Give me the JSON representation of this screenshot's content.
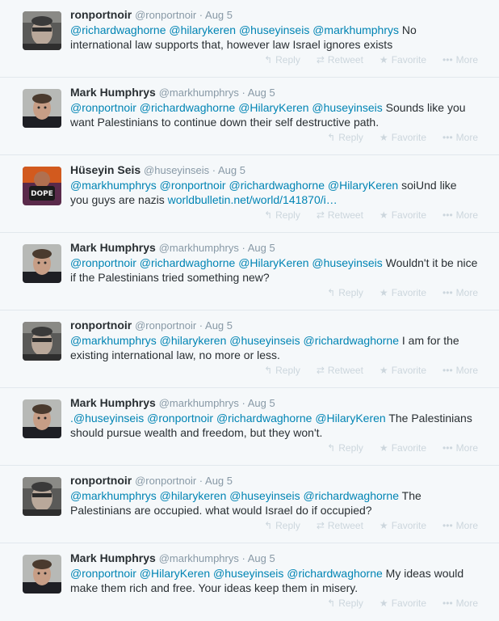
{
  "tweets": [
    {
      "avatar": "ronportnoir",
      "fullname": "ronportnoir",
      "username": "@ronportnoir",
      "date": "Aug 5",
      "mentions": "@richardwaghorne @hilarykeren @huseyinseis @markhumphrys",
      "text": " No international law supports that, however law Israel ignores exists",
      "link": "",
      "actions": {
        "reply": "Reply",
        "retweet": "Retweet",
        "favorite": "Favorite",
        "more": "More"
      }
    },
    {
      "avatar": "markhumphrys",
      "fullname": "Mark Humphrys",
      "username": "@markhumphrys",
      "date": "Aug 5",
      "mentions": "@ronportnoir @richardwaghorne @HilaryKeren @huseyinseis",
      "text": "  Sounds like you want Palestinians to continue down their self destructive path.",
      "link": "",
      "actions": {
        "reply": "Reply",
        "favorite": "Favorite",
        "more": "More"
      }
    },
    {
      "avatar": "huseyinseis",
      "fullname": "Hüseyin Seis",
      "username": "@huseyinseis",
      "date": "Aug 5",
      "mentions": "@markhumphrys @ronportnoir @richardwaghorne @HilaryKeren",
      "text": " soiUnd like you guys are nazis ",
      "link": "worldbulletin.net/world/141870/i…",
      "actions": {
        "reply": "Reply",
        "retweet": "Retweet",
        "favorite": "Favorite",
        "more": "More"
      }
    },
    {
      "avatar": "markhumphrys",
      "fullname": "Mark Humphrys",
      "username": "@markhumphrys",
      "date": "Aug 5",
      "mentions": "@ronportnoir @richardwaghorne @HilaryKeren @huseyinseis",
      "text": "  Wouldn't it be nice if the Palestinians tried something new?",
      "link": "",
      "actions": {
        "reply": "Reply",
        "favorite": "Favorite",
        "more": "More"
      }
    },
    {
      "avatar": "ronportnoir",
      "fullname": "ronportnoir",
      "username": "@ronportnoir",
      "date": "Aug 5",
      "mentions": "@markhumphrys @hilarykeren @huseyinseis @richardwaghorne",
      "text": " I am for the existing international law, no more or less.",
      "link": "",
      "actions": {
        "reply": "Reply",
        "retweet": "Retweet",
        "favorite": "Favorite",
        "more": "More"
      }
    },
    {
      "avatar": "markhumphrys",
      "fullname": "Mark Humphrys",
      "username": "@markhumphrys",
      "date": "Aug 5",
      "mentions": ".@huseyinseis @ronportnoir @richardwaghorne @HilaryKeren",
      "text": "   The Palestinians should pursue wealth and freedom, but they won't.",
      "link": "",
      "actions": {
        "reply": "Reply",
        "favorite": "Favorite",
        "more": "More"
      }
    },
    {
      "avatar": "ronportnoir",
      "fullname": "ronportnoir",
      "username": "@ronportnoir",
      "date": "Aug 5",
      "mentions": "@markhumphrys @hilarykeren @huseyinseis @richardwaghorne",
      "text": " The Palestinians are occupied. what would Israel do if occupied?",
      "link": "",
      "actions": {
        "reply": "Reply",
        "retweet": "Retweet",
        "favorite": "Favorite",
        "more": "More"
      }
    },
    {
      "avatar": "markhumphrys",
      "fullname": "Mark Humphrys",
      "username": "@markhumphrys",
      "date": "Aug 5",
      "mentions": "@ronportnoir @HilaryKeren @huseyinseis @richardwaghorne",
      "text": "  My ideas would make them rich and free. Your ideas keep them in misery.",
      "link": "",
      "actions": {
        "reply": "Reply",
        "favorite": "Favorite",
        "more": "More"
      }
    }
  ]
}
